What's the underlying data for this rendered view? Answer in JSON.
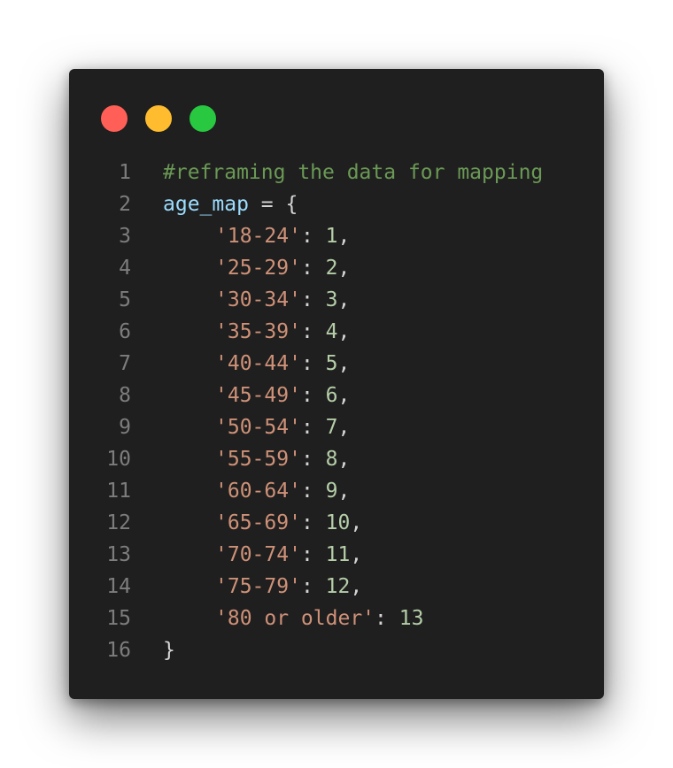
{
  "window": {
    "controls": [
      {
        "name": "close",
        "color": "#ff5f57"
      },
      {
        "name": "minimize",
        "color": "#febc2e"
      },
      {
        "name": "maximize",
        "color": "#28c840"
      }
    ]
  },
  "code": {
    "lines": [
      {
        "num": "1",
        "tokens": [
          {
            "t": "#reframing the data for mapping",
            "c": "comment"
          }
        ]
      },
      {
        "num": "2",
        "tokens": [
          {
            "t": "age_map",
            "c": "var"
          },
          {
            "t": " = {",
            "c": "op"
          }
        ]
      },
      {
        "num": "3",
        "indent": true,
        "tokens": [
          {
            "t": "'18-24'",
            "c": "str"
          },
          {
            "t": ": ",
            "c": "op"
          },
          {
            "t": "1",
            "c": "num"
          },
          {
            "t": ",",
            "c": "op"
          }
        ]
      },
      {
        "num": "4",
        "indent": true,
        "tokens": [
          {
            "t": "'25-29'",
            "c": "str"
          },
          {
            "t": ": ",
            "c": "op"
          },
          {
            "t": "2",
            "c": "num"
          },
          {
            "t": ",",
            "c": "op"
          }
        ]
      },
      {
        "num": "5",
        "indent": true,
        "tokens": [
          {
            "t": "'30-34'",
            "c": "str"
          },
          {
            "t": ": ",
            "c": "op"
          },
          {
            "t": "3",
            "c": "num"
          },
          {
            "t": ",",
            "c": "op"
          }
        ]
      },
      {
        "num": "6",
        "indent": true,
        "tokens": [
          {
            "t": "'35-39'",
            "c": "str"
          },
          {
            "t": ": ",
            "c": "op"
          },
          {
            "t": "4",
            "c": "num"
          },
          {
            "t": ",",
            "c": "op"
          }
        ]
      },
      {
        "num": "7",
        "indent": true,
        "tokens": [
          {
            "t": "'40-44'",
            "c": "str"
          },
          {
            "t": ": ",
            "c": "op"
          },
          {
            "t": "5",
            "c": "num"
          },
          {
            "t": ",",
            "c": "op"
          }
        ]
      },
      {
        "num": "8",
        "indent": true,
        "tokens": [
          {
            "t": "'45-49'",
            "c": "str"
          },
          {
            "t": ": ",
            "c": "op"
          },
          {
            "t": "6",
            "c": "num"
          },
          {
            "t": ",",
            "c": "op"
          }
        ]
      },
      {
        "num": "9",
        "indent": true,
        "tokens": [
          {
            "t": "'50-54'",
            "c": "str"
          },
          {
            "t": ": ",
            "c": "op"
          },
          {
            "t": "7",
            "c": "num"
          },
          {
            "t": ",",
            "c": "op"
          }
        ]
      },
      {
        "num": "10",
        "indent": true,
        "tokens": [
          {
            "t": "'55-59'",
            "c": "str"
          },
          {
            "t": ": ",
            "c": "op"
          },
          {
            "t": "8",
            "c": "num"
          },
          {
            "t": ",",
            "c": "op"
          }
        ]
      },
      {
        "num": "11",
        "indent": true,
        "tokens": [
          {
            "t": "'60-64'",
            "c": "str"
          },
          {
            "t": ": ",
            "c": "op"
          },
          {
            "t": "9",
            "c": "num"
          },
          {
            "t": ",",
            "c": "op"
          }
        ]
      },
      {
        "num": "12",
        "indent": true,
        "tokens": [
          {
            "t": "'65-69'",
            "c": "str"
          },
          {
            "t": ": ",
            "c": "op"
          },
          {
            "t": "10",
            "c": "num"
          },
          {
            "t": ",",
            "c": "op"
          }
        ]
      },
      {
        "num": "13",
        "indent": true,
        "tokens": [
          {
            "t": "'70-74'",
            "c": "str"
          },
          {
            "t": ": ",
            "c": "op"
          },
          {
            "t": "11",
            "c": "num"
          },
          {
            "t": ",",
            "c": "op"
          }
        ]
      },
      {
        "num": "14",
        "indent": true,
        "tokens": [
          {
            "t": "'75-79'",
            "c": "str"
          },
          {
            "t": ": ",
            "c": "op"
          },
          {
            "t": "12",
            "c": "num"
          },
          {
            "t": ",",
            "c": "op"
          }
        ]
      },
      {
        "num": "15",
        "indent": true,
        "tokens": [
          {
            "t": "'80 or older'",
            "c": "str"
          },
          {
            "t": ": ",
            "c": "op"
          },
          {
            "t": "13",
            "c": "num"
          }
        ]
      },
      {
        "num": "16",
        "tokens": [
          {
            "t": "}",
            "c": "op"
          }
        ]
      }
    ]
  }
}
